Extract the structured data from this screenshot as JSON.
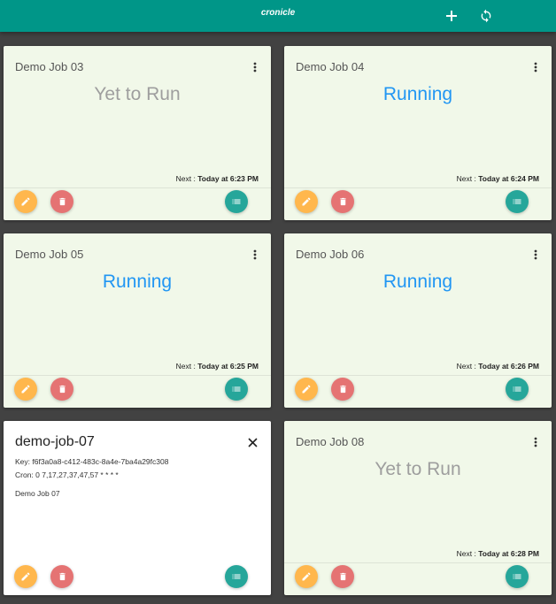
{
  "appbar": {
    "title": "cronicle",
    "add_icon": "plus-icon",
    "refresh_icon": "refresh-icon"
  },
  "colors": {
    "appbar": "#009688",
    "card_bg": "#f1f8e9",
    "running": "#2196f3",
    "idle": "#9e9e9e",
    "edit": "#ffb74d",
    "delete": "#e57373",
    "log": "#26a69a"
  },
  "labels": {
    "next_prefix": "Next : "
  },
  "jobs": [
    {
      "name": "Demo Job 03",
      "status": "Yet to Run",
      "next": "Today at 6:23 PM"
    },
    {
      "name": "Demo Job 04",
      "status": "Running",
      "next": "Today at 6:24 PM"
    },
    {
      "name": "Demo Job 05",
      "status": "Running",
      "next": "Today at 6:25 PM"
    },
    {
      "name": "Demo Job 06",
      "status": "Running",
      "next": "Today at 6:26 PM"
    },
    {
      "name": "Demo Job 08",
      "status": "Yet to Run",
      "next": "Today at 6:28 PM"
    }
  ],
  "detail": {
    "title": "demo-job-07",
    "key": "Key: f6f3a0a8-c412-483c-8a4e-7ba4a29fc308",
    "cron": "Cron: 0 7,17,27,37,47,57 * * * *",
    "description": "Demo Job 07"
  }
}
